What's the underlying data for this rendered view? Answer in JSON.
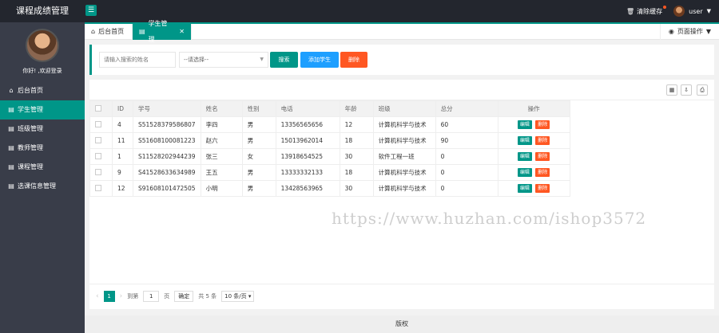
{
  "app": {
    "title": "课程成绩管理"
  },
  "header": {
    "clear_cache": "清除缓存",
    "user_name": "user"
  },
  "sidebar": {
    "greeting": "你好! ,欢迎登录",
    "items": [
      {
        "label": "后台首页",
        "icon": "home-icon"
      },
      {
        "label": "学生管理",
        "icon": "doc-icon"
      },
      {
        "label": "班级管理",
        "icon": "doc-icon"
      },
      {
        "label": "教师管理",
        "icon": "doc-icon"
      },
      {
        "label": "课程管理",
        "icon": "doc-icon"
      },
      {
        "label": "选课信息管理",
        "icon": "doc-icon"
      }
    ]
  },
  "tabs": [
    {
      "label": "后台首页"
    },
    {
      "label": "学生管理"
    }
  ],
  "page_ops": "页面操作",
  "search": {
    "placeholder": "请输入搜索的姓名",
    "select_value": "--请选择--",
    "search_btn": "搜索",
    "add_btn": "添加学生",
    "delete_btn": "删除"
  },
  "table": {
    "headers": [
      "ID",
      "学号",
      "姓名",
      "性别",
      "电话",
      "年龄",
      "班级",
      "总分",
      "操作"
    ],
    "rows": [
      [
        "4",
        "S51528379586807",
        "李四",
        "男",
        "13356565656",
        "12",
        "计算机科学与技术",
        "60"
      ],
      [
        "11",
        "S51608100081223",
        "赵六",
        "男",
        "15013962014",
        "18",
        "计算机科学与技术",
        "90"
      ],
      [
        "1",
        "S11528202944239",
        "张三",
        "女",
        "13918654525",
        "30",
        "软件工程一班",
        "0"
      ],
      [
        "9",
        "S41528633634989",
        "王五",
        "男",
        "13333332133",
        "18",
        "计算机科学与技术",
        "0"
      ],
      [
        "12",
        "S91608101472505",
        "小明",
        "男",
        "13428563965",
        "30",
        "计算机科学与技术",
        "0"
      ]
    ],
    "edit_label": "编辑",
    "delete_label": "删除"
  },
  "pager": {
    "current": "1",
    "goto_label": "到第",
    "goto_value": "1",
    "page_unit": "页",
    "confirm": "确定",
    "total": "共 5 条",
    "page_size": "10 条/页"
  },
  "footer": {
    "text": "版权"
  },
  "watermark": "https://www.huzhan.com/ishop3572",
  "colors": {
    "primary": "#009688",
    "blue": "#1e9fff",
    "danger": "#ff5722",
    "dark": "#23262e",
    "sidebar": "#393d49"
  }
}
